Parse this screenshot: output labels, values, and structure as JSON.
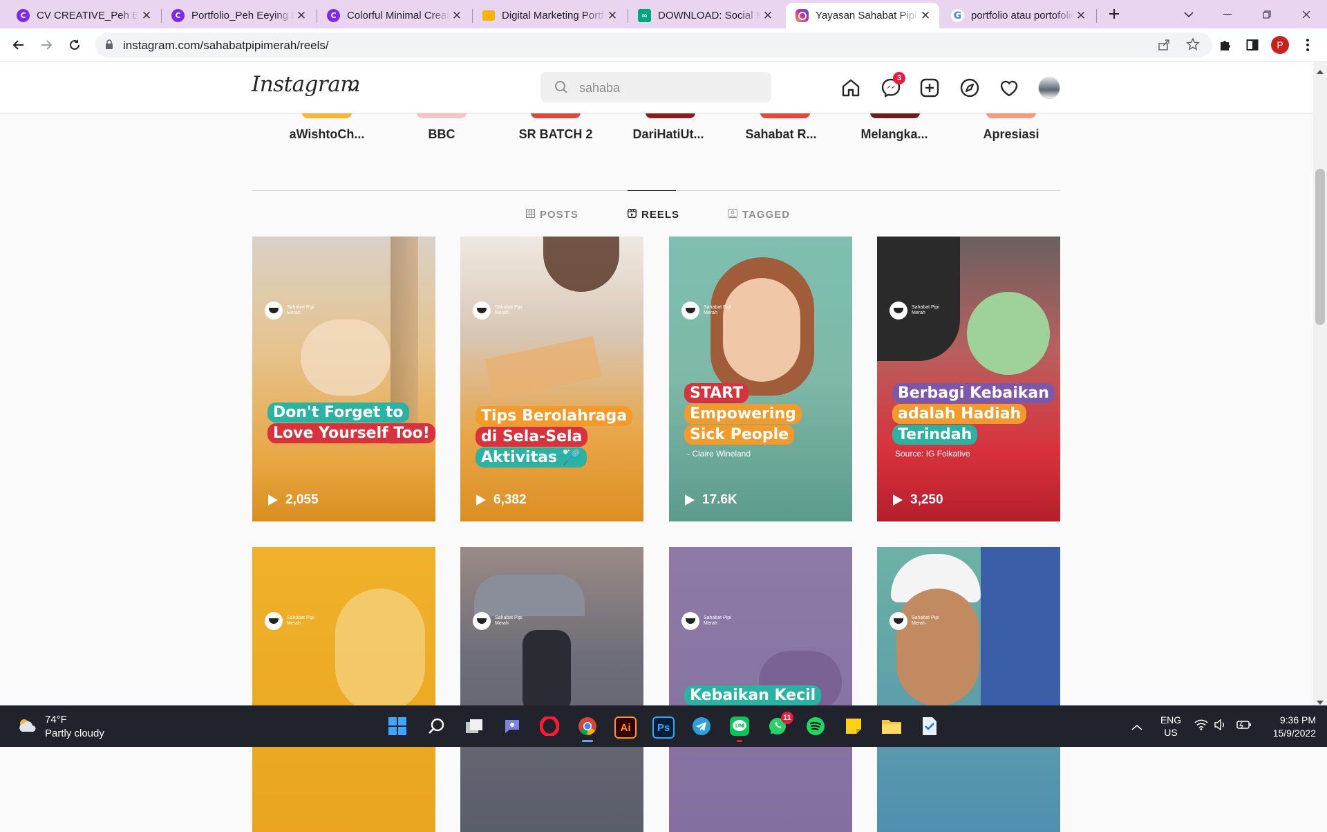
{
  "browser": {
    "tabs": [
      {
        "title": "CV CREATIVE_Peh Eeying",
        "icon": "canva-icon",
        "color": "#7d2ae8"
      },
      {
        "title": "Portfolio_Peh Eeying Digital",
        "icon": "canva-icon",
        "color": "#7d2ae8"
      },
      {
        "title": "Colorful Minimal Creative",
        "icon": "canva-icon",
        "color": "#7d2ae8"
      },
      {
        "title": "Digital Marketing Portfolio",
        "icon": "slides-icon",
        "color": "#f4b400"
      },
      {
        "title": "DOWNLOAD: Social Media",
        "icon": "download-icon",
        "color": "#00a67e"
      },
      {
        "title": "Yayasan Sahabat Pipi Merah",
        "icon": "instagram-icon",
        "color": "#d6249f",
        "active": true
      },
      {
        "title": "portfolio atau portofolio",
        "icon": "google-icon",
        "color": "#4285f4"
      }
    ],
    "url": "instagram.com/sahabatpipimerah/reels/",
    "profile_initial": "P"
  },
  "instagram": {
    "logo": "Instagram",
    "search_value": "sahaba",
    "messenger_badge": "3",
    "highlights": [
      "aWishtoCh...",
      "BBC",
      "SR BATCH 2",
      "DariHatiUt...",
      "Sahabat R...",
      "Melangka...",
      "Apresiasi"
    ],
    "profile_tabs": [
      {
        "label": "POSTS",
        "active": false
      },
      {
        "label": "REELS",
        "active": true
      },
      {
        "label": "TAGGED",
        "active": false
      }
    ],
    "brand_label": "Sahabat Pipi Merah",
    "reels": [
      {
        "views": "2,055",
        "caption": [
          "Don't Forget to",
          "Love Yourself Too!"
        ],
        "source": ""
      },
      {
        "views": "6,382",
        "caption": [
          "Tips Berolahraga",
          "di Sela-Sela",
          "Aktivitas 🏸"
        ],
        "source": ""
      },
      {
        "views": "17.6K",
        "caption": [
          "START",
          "Empowering",
          "Sick People"
        ],
        "source": "- Claire Wineland"
      },
      {
        "views": "3,250",
        "caption": [
          "Berbagi Kebaikan",
          "adalah Hadiah",
          "Terindah"
        ],
        "source": "Source: IG Folkative"
      },
      {
        "views": "",
        "caption": [],
        "source": ""
      },
      {
        "views": "",
        "caption": [],
        "source": ""
      },
      {
        "views": "",
        "caption": [
          "Kebaikan Kecil"
        ],
        "source": ""
      },
      {
        "views": "",
        "caption": [],
        "source": ""
      }
    ]
  },
  "taskbar": {
    "weather_temp": "74°F",
    "weather_desc": "Partly cloudy",
    "whatsapp_badge": "11",
    "lang": "ENG",
    "region": "US",
    "time": "9:36 PM",
    "date": "15/9/2022"
  }
}
